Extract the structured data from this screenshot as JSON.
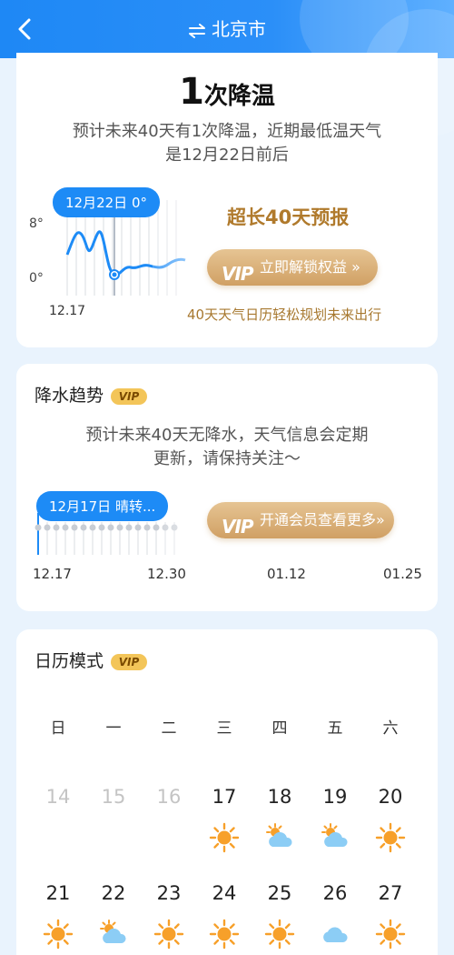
{
  "header": {
    "title": "北京市"
  },
  "cooling": {
    "count": "1",
    "title_suffix": "次降温",
    "desc_line1": "预计未来40天有1次降温，近期最低温天气",
    "desc_line2": "是12月22日前后",
    "tooltip": "12月22日 0°",
    "y_high": "8°",
    "y_low": "0°",
    "x_start": "12.17",
    "promo_title": "超长40天预报",
    "unlock_button": "立即解锁权益 »",
    "promo_sub": "40天天气日历轻松规划未来出行"
  },
  "precip": {
    "title": "降水趋势",
    "vip_badge": "VIP",
    "desc_line1": "预计未来40天无降水，天气信息会定期",
    "desc_line2": "更新，请保持关注～",
    "tooltip": "12月17日 晴转...",
    "vip_button": "开通会员查看更多»",
    "x_labels": [
      "12.17",
      "12.30",
      "01.12",
      "01.25"
    ]
  },
  "calendar": {
    "title": "日历模式",
    "vip_badge": "VIP",
    "weekdays": [
      "日",
      "一",
      "二",
      "三",
      "四",
      "五",
      "六"
    ],
    "week1": [
      {
        "day": "14",
        "dim": true,
        "icon": ""
      },
      {
        "day": "15",
        "dim": true,
        "icon": ""
      },
      {
        "day": "16",
        "dim": true,
        "icon": ""
      },
      {
        "day": "17",
        "dim": false,
        "icon": "sun-icon"
      },
      {
        "day": "18",
        "dim": false,
        "icon": "partly-cloudy-icon"
      },
      {
        "day": "19",
        "dim": false,
        "icon": "partly-cloudy-icon"
      },
      {
        "day": "20",
        "dim": false,
        "icon": "sun-icon"
      }
    ],
    "week2": [
      {
        "day": "21",
        "dim": false,
        "icon": "sun-icon"
      },
      {
        "day": "22",
        "dim": false,
        "icon": "partly-cloudy-icon"
      },
      {
        "day": "23",
        "dim": false,
        "icon": "sun-icon"
      },
      {
        "day": "24",
        "dim": false,
        "icon": "sun-icon"
      },
      {
        "day": "25",
        "dim": false,
        "icon": "sun-icon"
      },
      {
        "day": "26",
        "dim": false,
        "icon": "cloud-icon"
      },
      {
        "day": "27",
        "dim": false,
        "icon": "sun-icon"
      }
    ]
  },
  "colors": {
    "primary": "#1d8bf6",
    "gold": "#b07a2c",
    "sun": "#f7a02a",
    "cloud": "#8ccdf5"
  }
}
